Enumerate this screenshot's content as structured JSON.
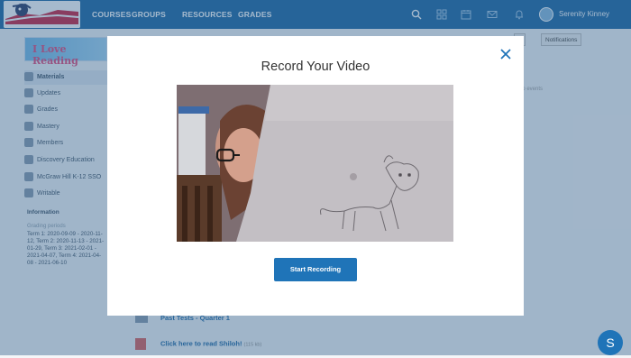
{
  "header": {
    "nav": [
      "COURSES",
      "GROUPS",
      "RESOURCES",
      "GRADES"
    ],
    "user_name": "Serenity Kinney",
    "icons": [
      "search-icon",
      "apps-grid-icon",
      "calendar-icon",
      "mail-icon",
      "bell-icon"
    ]
  },
  "sidebar": {
    "banner_text": "I Love Reading",
    "items": [
      {
        "label": "Materials",
        "icon": "folder-icon"
      },
      {
        "label": "Updates",
        "icon": "updates-icon"
      },
      {
        "label": "Grades",
        "icon": "grades-icon"
      },
      {
        "label": "Mastery",
        "icon": "mastery-icon"
      },
      {
        "label": "Members",
        "icon": "members-icon"
      },
      {
        "label": "Discovery Education",
        "icon": "discovery-icon"
      },
      {
        "label": "McGraw Hill K-12 SSO",
        "icon": "mcgraw-icon"
      },
      {
        "label": "Writable",
        "icon": "writable-icon"
      }
    ],
    "info_heading": "Information",
    "info_subheading": "Grading periods",
    "info_text": "Term 1: 2020-09-09 - 2020-11-12, Term 2: 2020-11-13 - 2021-01-29, Term 3: 2021-02-01 - 2021-04-07, Term 4: 2021-04-08 - 2021-06-10"
  },
  "main": {
    "rows": [
      {
        "label": "Past Tests - Quarter 1"
      },
      {
        "label": "Click here to read Shiloh!",
        "meta": "(115 kb)"
      }
    ],
    "notifications_label": "Notifications",
    "upcoming_hint": "No events"
  },
  "modal": {
    "title": "Record Your Video",
    "record_button": "Start Recording",
    "close_icon": "close-icon"
  },
  "chat_button": "S",
  "colors": {
    "brand": "#0b5a9c",
    "button": "#1f74b8",
    "overlay": "rgba(70,110,150,0.48)"
  }
}
